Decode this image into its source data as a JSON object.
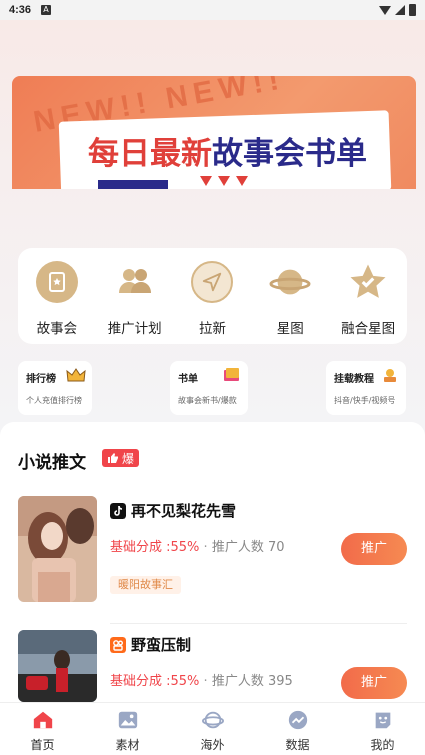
{
  "status_bar": {
    "time": "4:36",
    "notification_letter": "A"
  },
  "banner": {
    "bg_text": "NEW!! NEW!!",
    "title_part1": "每日最新",
    "title_part2": "故事会书单"
  },
  "menu": [
    {
      "label": "故事会",
      "icon": "story-icon"
    },
    {
      "label": "推广计划",
      "icon": "people-icon"
    },
    {
      "label": "拉新",
      "icon": "send-icon"
    },
    {
      "label": "星图",
      "icon": "planet-icon"
    },
    {
      "label": "融合星图",
      "icon": "star-icon"
    }
  ],
  "mini_cards": [
    {
      "title": "排行榜",
      "sub": "个人充值排行榜",
      "icon": "crown-icon"
    },
    {
      "title": "书单",
      "sub": "故事会新书/爆款",
      "icon": "book-icon"
    },
    {
      "title": "挂载教程",
      "sub": "抖音/快手/视频号",
      "icon": "tutorial-icon"
    }
  ],
  "feed": {
    "title": "小说推文",
    "badge": "爆",
    "books": [
      {
        "name": "再不见梨花先雪",
        "platform": "douyin-icon",
        "rate": "基础分成 :55%",
        "separator": " · ",
        "count": "推广人数 70",
        "tag": "暖阳故事汇",
        "button": "推广"
      },
      {
        "name": "野蛮压制",
        "platform": "kuaishou-icon",
        "rate": "基础分成 :55%",
        "separator": " · ",
        "count": "推广人数 395",
        "tag": "",
        "button": "推广"
      }
    ]
  },
  "tabs": [
    {
      "label": "首页",
      "icon": "home-icon",
      "active": true
    },
    {
      "label": "素材",
      "icon": "image-icon",
      "active": false
    },
    {
      "label": "海外",
      "icon": "globe-icon",
      "active": false
    },
    {
      "label": "数据",
      "icon": "chart-icon",
      "active": false
    },
    {
      "label": "我的",
      "icon": "profile-icon",
      "active": false
    }
  ],
  "colors": {
    "accent": "#f0454a",
    "menu_icon": "#d6b787",
    "promote_start": "#f26b4a",
    "promote_end": "#f68a52",
    "tab_active": "#f0454a",
    "tab_inactive": "#9aa7c4"
  }
}
